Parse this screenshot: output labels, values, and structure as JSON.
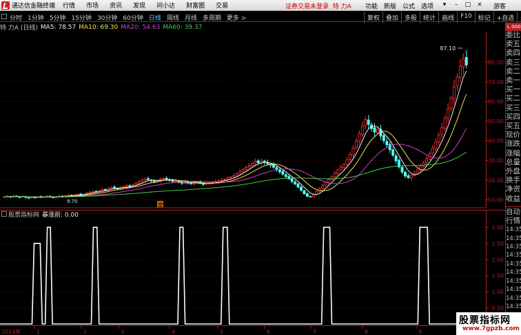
{
  "titlebar": {
    "app_title": "通达信金融终端",
    "menus": [
      "行情",
      "市场",
      "资讯",
      "发现",
      "问小达",
      "财富圈",
      "交易"
    ],
    "login_warning": "证券交易未登录",
    "stock_name": "特 力A",
    "right_items": [
      "功能",
      "新版",
      "公式",
      "选项"
    ],
    "window_buttons": [
      "▾",
      "–",
      "□",
      "×"
    ],
    "user_status": "游客"
  },
  "toolbar": {
    "periods": [
      "分时",
      "1分钟",
      "5分钟",
      "15分钟",
      "30分钟",
      "60分钟",
      "日线",
      "周线",
      "月线",
      "多周期",
      "更多 >"
    ],
    "active_period": "日线",
    "right_tools": [
      "复权",
      "叠加",
      "多股",
      "统计",
      "画线",
      "F10",
      "标记",
      "+自选",
      "返回"
    ]
  },
  "info": {
    "label": "特 力A (日线)",
    "ma5": "MA5: 78.57",
    "ma10": "MA10: 69.30",
    "ma20": "MA20: 54.63",
    "ma60": "MA60: 39.37",
    "colors": {
      "label": "#c0c0c0",
      "ma5": "#f0f0f0",
      "ma10": "#f2e45a",
      "ma20": "#d040d0",
      "ma60": "#40d040"
    }
  },
  "price_axis": {
    "ticks": [
      "80.00",
      "70.00",
      "60.00",
      "50.00",
      "40.00",
      "30.00",
      "20.00",
      "10.00"
    ],
    "high_label": "87.10",
    "low_label": "9.70",
    "marker": "定"
  },
  "indicator": {
    "name": "股票指标网",
    "title": "暴涨前: 0.00",
    "ticks": [
      "3.00",
      "2.50",
      "2.00",
      "1.50",
      "1.00",
      "0.50"
    ]
  },
  "date_axis": {
    "year": "2014年",
    "months": [
      "1",
      "2",
      "3",
      "4",
      "5",
      "6",
      "7",
      "8",
      "9",
      "10"
    ]
  },
  "right_panel": {
    "top_label": "L 000",
    "labels": [
      "委比",
      "卖五",
      "卖四",
      "卖三",
      "卖二",
      "卖一",
      "买一",
      "买二",
      "买三",
      "买四",
      "买五",
      "现价",
      "涨跌",
      "涨幅",
      "总量",
      "外盘",
      "换手",
      "净资",
      "收益"
    ],
    "section": "自动",
    "section2": "行情",
    "times": [
      "14:35",
      "14:35",
      "14:35",
      "14:35",
      "14:35",
      "14:35",
      "14:35",
      "14:35",
      "14:35",
      "14:35"
    ]
  },
  "watermark": {
    "line1": "股票指标网",
    "line2": "www.7gpzb.com"
  },
  "chart_data": [
    {
      "type": "candlestick",
      "title": "特 力A (日线)",
      "ylim": [
        7,
        92
      ],
      "y_ticks": [
        10,
        20,
        30,
        40,
        50,
        60,
        70,
        80
      ],
      "high": 87.1,
      "low": 9.7,
      "close_series": [
        11.5,
        11.8,
        11.4,
        11.9,
        11.6,
        11.3,
        11.7,
        11.2,
        11.0,
        11.4,
        11.2,
        11.6,
        11.3,
        11.5,
        11.8,
        11.4,
        11.2,
        11.5,
        11.9,
        11.6,
        12.0,
        12.3,
        12.0,
        12.4,
        12.8,
        12.5,
        13.0,
        13.4,
        13.9,
        14.3,
        14.0,
        14.6,
        15.2,
        15.0,
        15.8,
        16.4,
        16.0,
        15.6,
        16.2,
        16.8,
        17.2,
        16.9,
        17.5,
        18.3,
        19.2,
        20.0,
        20.6,
        20.2,
        19.6,
        19.2,
        19.8,
        20.4,
        20.9,
        20.4,
        19.8,
        19.3,
        19.6,
        18.8,
        18.4,
        18.9,
        18.6,
        18.2,
        18.6,
        18.9,
        18.3,
        17.8,
        18.2,
        18.6,
        18.9,
        19.3,
        19.7,
        20.0,
        20.4,
        21.0,
        21.6,
        22.3,
        23.2,
        24.5,
        25.4,
        26.4,
        27.5,
        28.4,
        29.6,
        28.8,
        29.5,
        29.0,
        28.3,
        27.6,
        26.5,
        25.3,
        24.2,
        23.0,
        21.8,
        20.6,
        19.3,
        18.0,
        16.5,
        14.8,
        13.0,
        11.8,
        11.5,
        12.6,
        14.2,
        15.8,
        17.4,
        18.9,
        20.3,
        21.8,
        23.5,
        25.2,
        26.6,
        28.0,
        30.4,
        33.1,
        36.2,
        39.8,
        43.6,
        47.5,
        50.8,
        48.3,
        46.2,
        44.4,
        45.8,
        42.4,
        40.1,
        37.9,
        35.4,
        32.6,
        29.8,
        26.7,
        24.1,
        22.1,
        21.3,
        22.4,
        23.7,
        25.2,
        26.9,
        28.8,
        30.9,
        33.4,
        36.3,
        39.5,
        43.0,
        46.8,
        51.5,
        56.3,
        61.8,
        67.5,
        72.4,
        77.9,
        81.6,
        78.5
      ],
      "series": [
        {
          "name": "MA5",
          "value": 78.57
        },
        {
          "name": "MA10",
          "value": 69.3
        },
        {
          "name": "MA20",
          "value": 54.63
        },
        {
          "name": "MA60",
          "value": 39.37
        }
      ]
    },
    {
      "type": "line",
      "title": "暴涨前: 0.00",
      "ylim": [
        0,
        3.2
      ],
      "y_ticks": [
        0.5,
        1.0,
        1.5,
        2.0,
        2.5,
        3.0
      ],
      "signal_windows": [
        {
          "level": 2.5,
          "start": 0.066,
          "end": 0.087
        },
        {
          "level": 3.0,
          "start": 0.093,
          "end": 0.108
        },
        {
          "level": 3.0,
          "start": 0.188,
          "end": 0.204
        },
        {
          "level": 3.0,
          "start": 0.366,
          "end": 0.381
        },
        {
          "level": 3.0,
          "start": 0.455,
          "end": 0.472
        },
        {
          "level": 3.0,
          "start": 0.662,
          "end": 0.683
        },
        {
          "level": 3.0,
          "start": 0.86,
          "end": 0.884
        }
      ]
    }
  ]
}
